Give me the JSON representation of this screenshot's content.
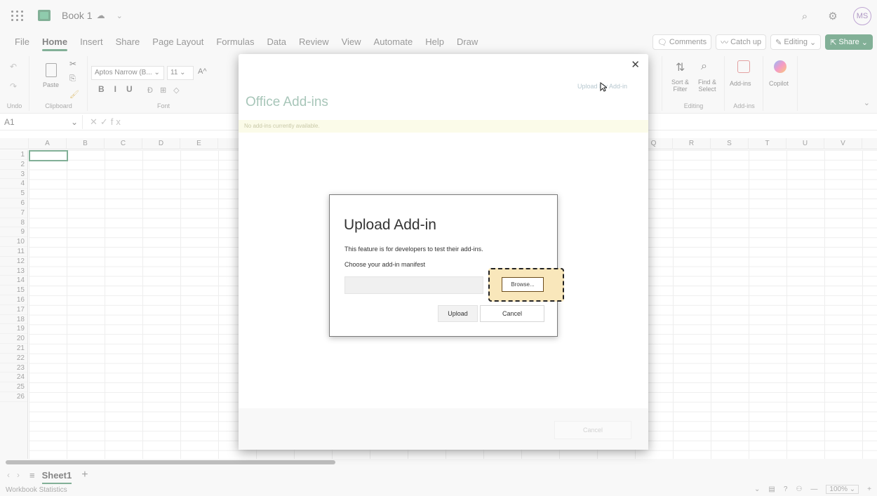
{
  "titlebar": {
    "book_title": "Book 1",
    "avatar_initials": "MS"
  },
  "menu": {
    "tabs": [
      "File",
      "Home",
      "Insert",
      "Share",
      "Page Layout",
      "Formulas",
      "Data",
      "Review",
      "View",
      "Automate",
      "Help",
      "Draw"
    ],
    "active": "Home",
    "comments": "Comments",
    "catch_up": "Catch up",
    "editing": "Editing",
    "share": "Share"
  },
  "ribbon": {
    "undo_label": "Undo",
    "paste_label": "Paste",
    "clipboard_label": "Clipboard",
    "font_name": "Aptos Narrow (B...",
    "font_size": "11",
    "font_label": "Font",
    "sort_filter": "Sort &",
    "sort_filter_2": "Filter",
    "find_select": "Find &",
    "find_select_2": "Select",
    "editing_label": "Editing",
    "addins_button": "Add-ins",
    "addins_label": "Add-ins",
    "copilot": "Copilot"
  },
  "formula_bar": {
    "name_box": "A1",
    "fx": "fx"
  },
  "grid": {
    "columns": [
      "A",
      "B",
      "C",
      "D",
      "E",
      "Q",
      "R",
      "S",
      "T",
      "U",
      "V"
    ],
    "rows": [
      "1",
      "2",
      "3",
      "4",
      "5",
      "6",
      "7",
      "8",
      "9",
      "10",
      "11",
      "12",
      "13",
      "14",
      "15",
      "16",
      "17",
      "18",
      "19",
      "20",
      "21",
      "22",
      "23",
      "24",
      "25",
      "26"
    ]
  },
  "sheets": {
    "active": "Sheet1"
  },
  "status": {
    "left": "Workbook Statistics",
    "zoom": "100%"
  },
  "addins_dialog": {
    "title": "Office Add-ins",
    "upload_link": "Upload My Add-in",
    "banner": "No add-ins currently available.",
    "footer_cancel": "Cancel"
  },
  "upload_dialog": {
    "title": "Upload Add-in",
    "description": "This feature is for developers to test their add-ins.",
    "choose_label": "Choose your add-in manifest",
    "browse": "Browse...",
    "upload": "Upload",
    "cancel": "Cancel"
  },
  "colors": {
    "accent": "#1d6f42",
    "highlight": "#f9e7bb"
  }
}
